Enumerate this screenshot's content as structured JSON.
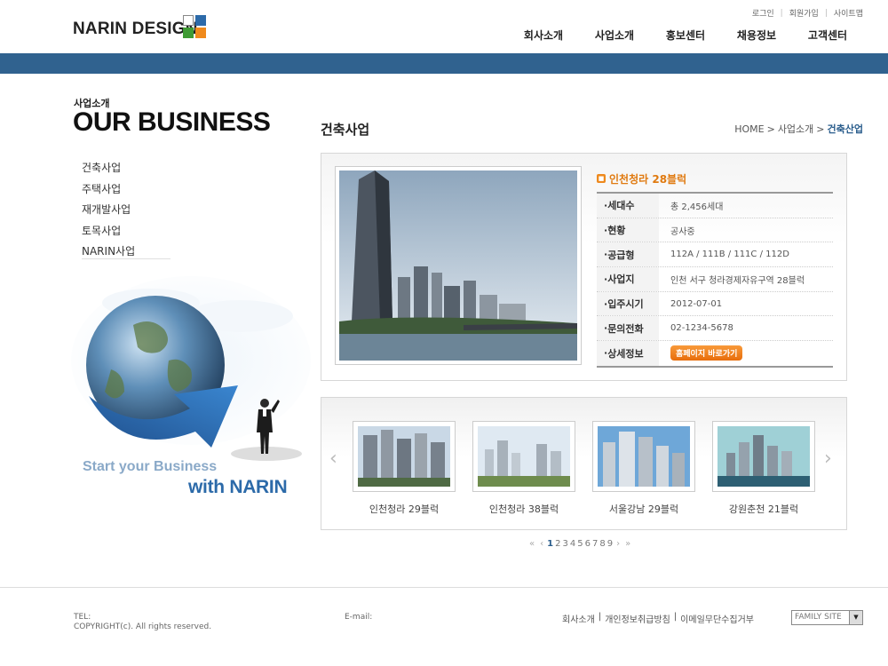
{
  "header": {
    "logo_text": "NARIN DESIGN",
    "util_links": [
      "로그인",
      "회원가입",
      "사이트맵"
    ],
    "gnb": [
      "회사소개",
      "사업소개",
      "홍보센터",
      "채용정보",
      "고객센터"
    ]
  },
  "side": {
    "sub_kr": "사업소개",
    "sub_en": "OUR BUSINESS",
    "menu": [
      "건축사업",
      "주택사업",
      "재개발사업",
      "토목사업",
      "NARIN사업"
    ],
    "slogan_line1": "Start your Business",
    "slogan_line2": "with NARIN"
  },
  "content": {
    "title": "건축사업",
    "breadcrumb": [
      "HOME",
      "사업소개",
      "건축산업"
    ],
    "project_title": "인천청라 28블럭",
    "spec": [
      {
        "k": "세대수",
        "v": "총 2,456세대"
      },
      {
        "k": "현황",
        "v": "공사중"
      },
      {
        "k": "공급형",
        "v": "112A / 111B / 111C / 112D"
      },
      {
        "k": "사업지",
        "v": "인천 서구 청라경제자유구역 28블럭"
      },
      {
        "k": "입주시기",
        "v": "2012-07-01"
      },
      {
        "k": "문의전화",
        "v": "02-1234-5678"
      },
      {
        "k": "상세정보",
        "v": ""
      }
    ],
    "homepage_button": "홈페이지 바로가기",
    "gallery": [
      "인천청라 29블럭",
      "인천청라 38블럭",
      "서울강남 29블럭",
      "강원춘천 21블럭"
    ],
    "pager": {
      "first": "«",
      "prev": "‹",
      "pages": [
        "1",
        "2",
        "3",
        "4",
        "5",
        "6",
        "7",
        "8",
        "9"
      ],
      "current": "1",
      "next": "›",
      "last": "»"
    }
  },
  "footer": {
    "tel": "TEL:",
    "copyright": "COPYRIGHT(c). All rights reserved.",
    "email": "E-mail:",
    "links": [
      "회사소개",
      "개인정보취급방침",
      "이메일무단수집거부"
    ],
    "family_site": "FAMILY SITE"
  },
  "colors": {
    "brand_blue": "#30628f",
    "accent_orange": "#e86d0b",
    "logo_red": "#e4352b",
    "logo_green": "#3f9b34",
    "logo_orange": "#f08a1c"
  }
}
